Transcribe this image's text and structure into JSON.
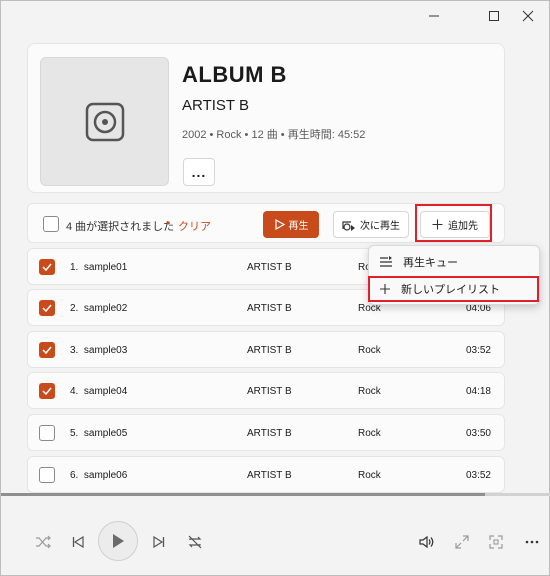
{
  "album": {
    "title": "ALBUM B",
    "artist": "ARTIST B",
    "meta": "2002 • Rock • 12 曲 • 再生時間: 45:52",
    "more_label": "..."
  },
  "selection": {
    "text": "4 曲が選択されました",
    "dot": "•",
    "clear_label": "クリア",
    "play_label": "再生",
    "next_label": "次に再生",
    "add_label": "追加先"
  },
  "menu": {
    "items": [
      {
        "label": "再生キュー",
        "icon": "queue-icon"
      },
      {
        "label": "新しいプレイリスト",
        "icon": "plus-icon"
      }
    ]
  },
  "tracks": [
    {
      "num": "1.",
      "title": "sample01",
      "artist": "ARTIST B",
      "genre": "Rock",
      "duration": "",
      "checked": true
    },
    {
      "num": "2.",
      "title": "sample02",
      "artist": "ARTIST B",
      "genre": "Rock",
      "duration": "04:06",
      "checked": true
    },
    {
      "num": "3.",
      "title": "sample03",
      "artist": "ARTIST B",
      "genre": "Rock",
      "duration": "03:52",
      "checked": true
    },
    {
      "num": "4.",
      "title": "sample04",
      "artist": "ARTIST B",
      "genre": "Rock",
      "duration": "04:18",
      "checked": true
    },
    {
      "num": "5.",
      "title": "sample05",
      "artist": "ARTIST B",
      "genre": "Rock",
      "duration": "03:50",
      "checked": false
    },
    {
      "num": "6.",
      "title": "sample06",
      "artist": "ARTIST B",
      "genre": "Rock",
      "duration": "03:52",
      "checked": false
    }
  ],
  "player": {
    "progress": 0.88
  },
  "colors": {
    "accent": "#c84b1c",
    "highlight": "#e0202a"
  }
}
